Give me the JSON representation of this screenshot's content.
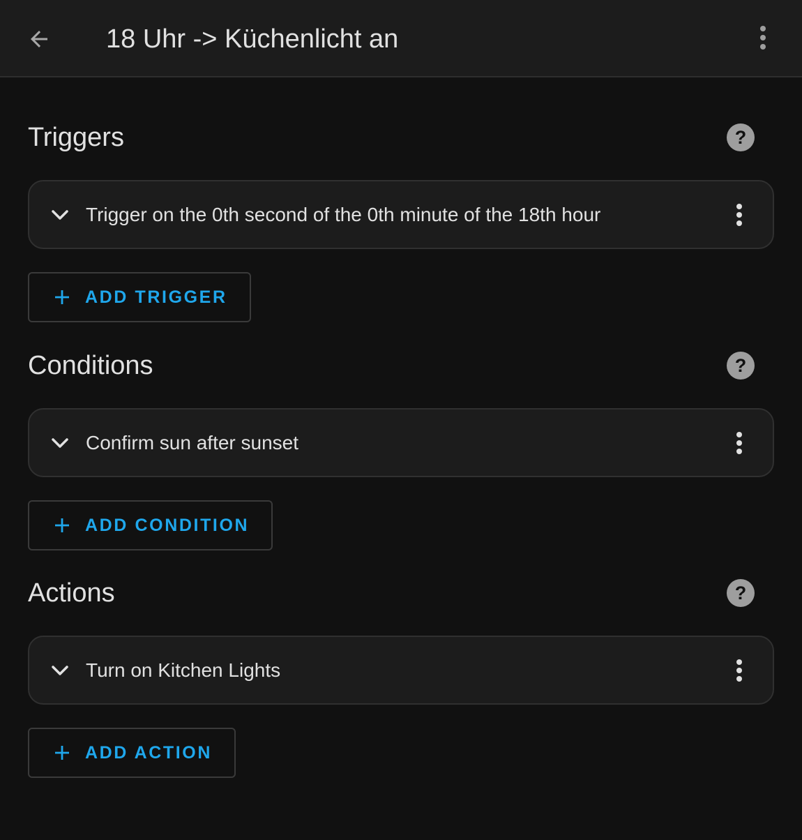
{
  "header": {
    "title": "18 Uhr -> Küchenlicht an",
    "back_icon": "arrow-left-icon",
    "menu_icon": "dots-vertical-icon"
  },
  "colors": {
    "background": "#111111",
    "card": "#1c1c1c",
    "accent": "#1fa7ec",
    "help_icon": "#9e9e9e"
  },
  "sections": {
    "triggers": {
      "title": "Triggers",
      "items": [
        {
          "label": "Trigger on the 0th second of the 0th minute of the 18th hour"
        }
      ],
      "add_label": "ADD TRIGGER"
    },
    "conditions": {
      "title": "Conditions",
      "items": [
        {
          "label": "Confirm sun after sunset"
        }
      ],
      "add_label": "ADD CONDITION"
    },
    "actions": {
      "title": "Actions",
      "items": [
        {
          "label": "Turn on Kitchen Lights"
        }
      ],
      "add_label": "ADD ACTION"
    }
  }
}
